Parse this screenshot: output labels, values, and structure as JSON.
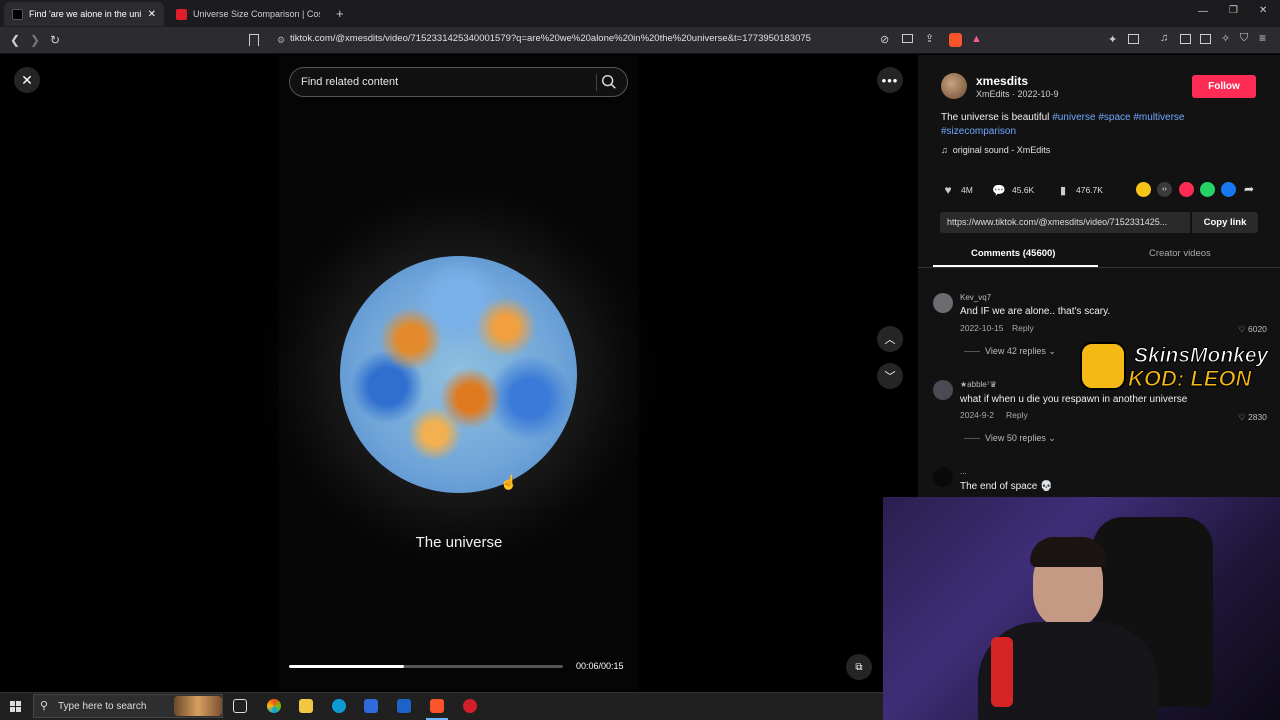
{
  "browser": {
    "tabs": [
      {
        "title": "Find 'are we alone in the uni",
        "active": true
      },
      {
        "title": "Universe Size Comparison | Cosmic E",
        "active": false
      }
    ],
    "url": "tiktok.com/@xmesdits/video/7152331425340001579?q=are%20we%20alone%20in%20the%20universe&t=1773950183075"
  },
  "player": {
    "search_placeholder": "Find related content",
    "caption": "The universe",
    "time": "00:06/00:15",
    "progress": 0.42
  },
  "video": {
    "username": "xmesdits",
    "meta": "XmEdits · 2022-10-9",
    "follow_label": "Follow",
    "description": "The universe is beautiful",
    "hashtags": [
      "#universe",
      "#space",
      "#multiverse",
      "#sizecomparison"
    ],
    "sound": "original sound - XmEdits",
    "likes": "4M",
    "comments_count": "45.6K",
    "saves": "476.7K",
    "link": "https://www.tiktok.com/@xmesdits/video/7152331425...",
    "copy_label": "Copy link"
  },
  "panel_tabs": {
    "comments": "Comments (45600)",
    "creator": "Creator videos"
  },
  "comments": [
    {
      "user": "Kev_vq7",
      "text": "And IF we are alone.. that's scary.",
      "date": "2022-10-15",
      "reply": "Reply",
      "likes": "6020",
      "replies": "View 42 replies"
    },
    {
      "user": "★abble⁷♛",
      "text": "what if when u die you respawn in another universe",
      "date": "2024-9-2",
      "reply": "Reply",
      "likes": "2830",
      "replies": "View 50 replies"
    },
    {
      "user": "...",
      "text": "The end of space 💀"
    }
  ],
  "sponsor": {
    "line1": "SkinsMonkey",
    "line2": "KOD: LEON"
  },
  "taskbar": {
    "search_placeholder": "Type here to search"
  }
}
